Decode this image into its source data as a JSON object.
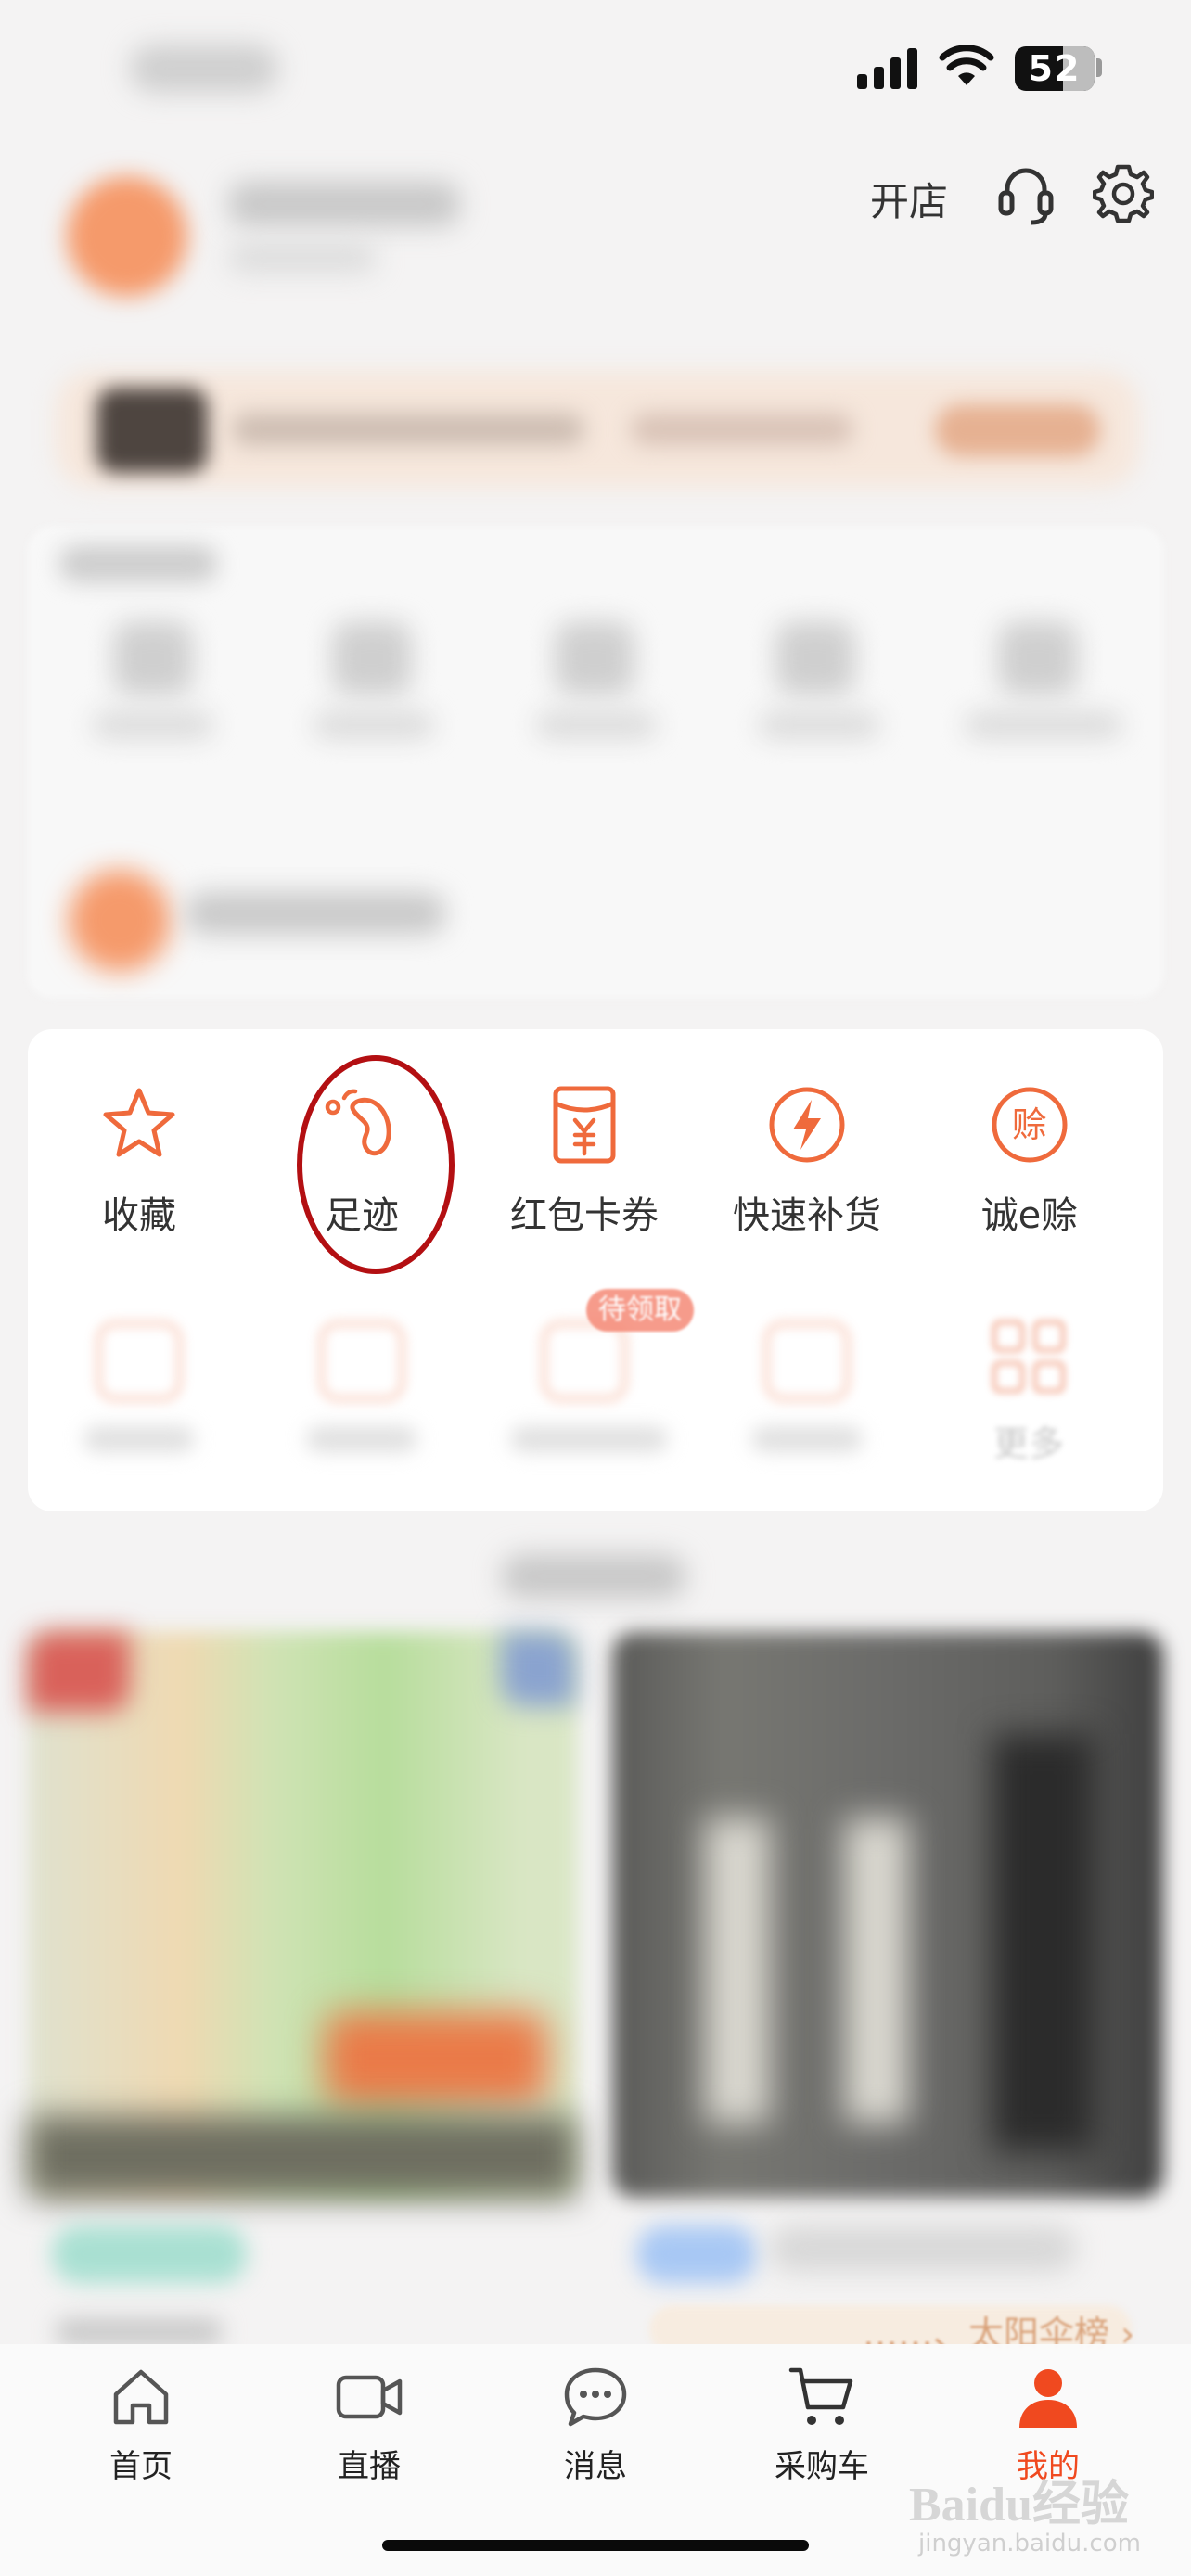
{
  "status_bar": {
    "battery_level": "52"
  },
  "header": {
    "open_store_label": "开店",
    "icons": [
      "headset-icon",
      "gear-icon"
    ]
  },
  "tools": [
    {
      "label": "收藏",
      "icon": "star-icon"
    },
    {
      "label": "足迹",
      "icon": "footprint-icon"
    },
    {
      "label": "红包卡券",
      "icon": "red-envelope-icon"
    },
    {
      "label": "快速补货",
      "icon": "lightning-icon"
    },
    {
      "label": "诚e赊",
      "icon": "credit-icon",
      "icon_char": "赊"
    }
  ],
  "tools_row2": {
    "badge": "待领取",
    "more_label": "更多"
  },
  "recommend": {
    "rank_text": "……、太阳伞榜 ›"
  },
  "tabbar": {
    "items": [
      {
        "label": "首页",
        "icon": "home-icon"
      },
      {
        "label": "直播",
        "icon": "video-camera-icon"
      },
      {
        "label": "消息",
        "icon": "chat-icon"
      },
      {
        "label": "采购车",
        "icon": "cart-icon"
      },
      {
        "label": "我的",
        "icon": "profile-icon",
        "active": true
      }
    ]
  },
  "watermark": {
    "text": "Baidu经验",
    "sub": "jingyan.baidu.com"
  },
  "colors": {
    "accent": "#f0491f",
    "icon_orange": "#ef6a3c",
    "annotation_circle": "#b30f12",
    "background": "#f4f3f3"
  }
}
